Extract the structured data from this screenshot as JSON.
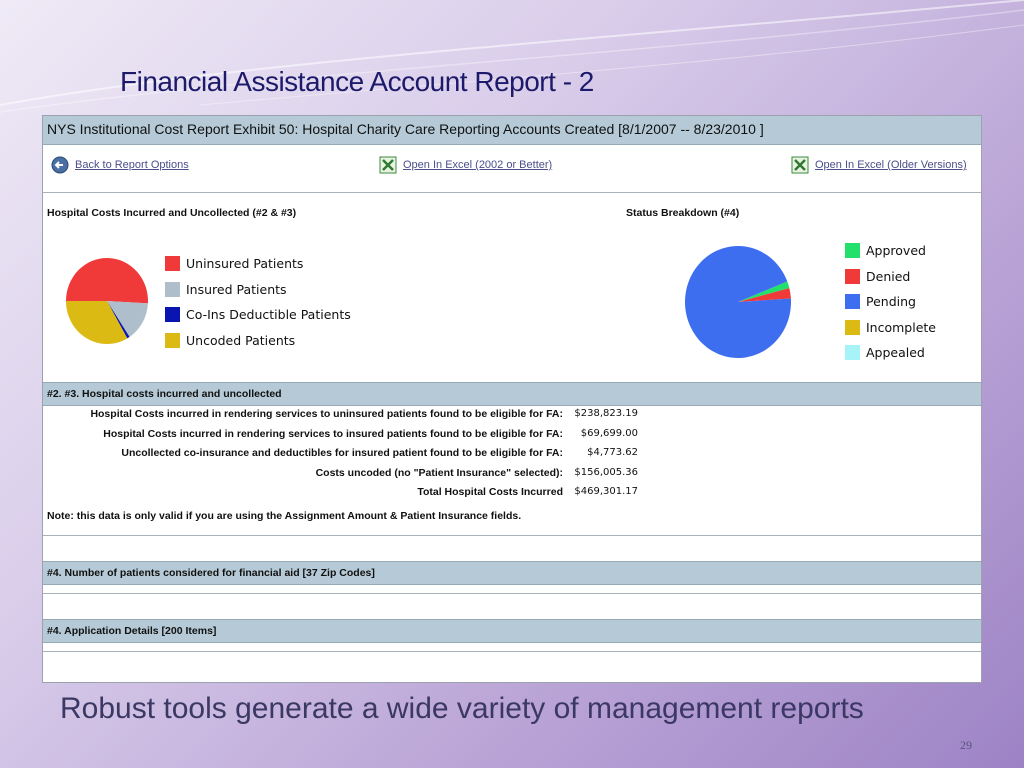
{
  "slide": {
    "title": "Financial Assistance Account Report - 2",
    "caption": "Robust tools generate a wide variety of management reports",
    "page_number": "29"
  },
  "report": {
    "header": "NYS Institutional Cost Report Exhibit 50: Hospital Charity Care Reporting Accounts Created [8/1/2007 -- 8/23/2010 ]",
    "links": {
      "back": "Back to Report Options",
      "excel_new": "Open In Excel (2002 or Better)",
      "excel_old": "Open In Excel (Older Versions)"
    },
    "costs_chart_label": "Hospital Costs Incurred and Uncollected (#2 & #3)",
    "status_chart_label": "Status Breakdown (#4)",
    "section_costs": "#2. #3. Hospital costs incurred and uncollected",
    "cost_rows": [
      {
        "label": "Hospital Costs incurred in rendering services to uninsured patients found to be eligible for FA:",
        "value": "$238,823.19"
      },
      {
        "label": "Hospital Costs incurred in rendering services to insured patients found to be eligible for FA:",
        "value": "$69,699.00"
      },
      {
        "label": "Uncollected co-insurance and deductibles for insured patient found to be eligible for FA:",
        "value": "$4,773.62"
      },
      {
        "label": "Costs uncoded (no \"Patient Insurance\" selected):",
        "value": "$156,005.36"
      },
      {
        "label": "Total Hospital Costs Incurred",
        "value": "$469,301.17"
      }
    ],
    "note": "Note: this data is only valid if you are using the Assignment Amount & Patient Insurance fields.",
    "section_patients": "#4. Number of patients considered for financial aid [37 Zip Codes]",
    "section_applications": "#4. Application Details [200 Items]"
  },
  "chart_data": [
    {
      "type": "pie",
      "title": "Hospital Costs Incurred and Uncollected (#2 & #3)",
      "labels": [
        "Uninsured Patients",
        "Insured Patients",
        "Co-Ins Deductible Patients",
        "Uncoded Patients"
      ],
      "values": [
        238823.19,
        69699.0,
        4773.62,
        156005.36
      ],
      "colors": [
        "#f03a3a",
        "#aebfcb",
        "#0a14b0",
        "#dcba14"
      ],
      "legend": "right"
    },
    {
      "type": "pie",
      "title": "Status Breakdown (#4)",
      "labels": [
        "Approved",
        "Denied",
        "Pending",
        "Incomplete",
        "Appealed"
      ],
      "values": [
        2,
        3,
        95,
        0,
        0
      ],
      "colors": [
        "#22e06a",
        "#f03a3a",
        "#3e6ef0",
        "#dcba14",
        "#a6f3f8"
      ],
      "legend": "right"
    }
  ]
}
